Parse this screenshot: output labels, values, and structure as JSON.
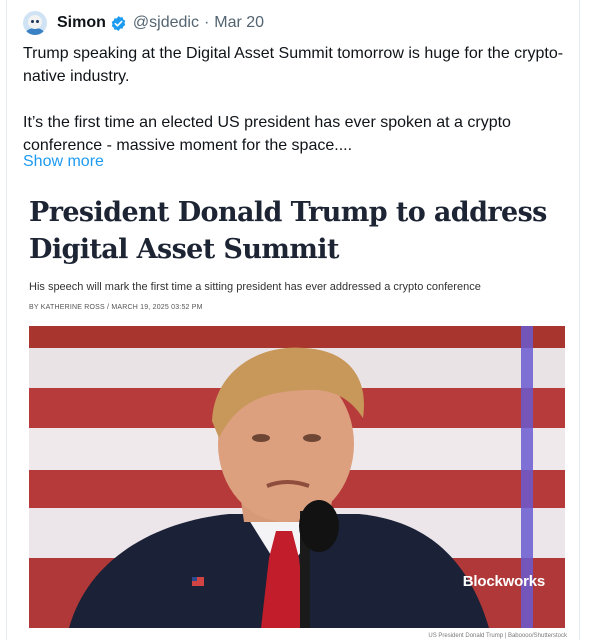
{
  "tweet": {
    "author": {
      "name": "Simon",
      "handle": "@sjdedic",
      "date": "Mar 20"
    },
    "text_lines": [
      "Trump speaking at the Digital Asset Summit tomorrow is huge for the crypto-native industry.",
      "It’s the first time an elected US president has ever spoken at a crypto conference - massive moment for the space...."
    ],
    "show_more": "Show more"
  },
  "card": {
    "headline": "President Donald Trump to address Digital Asset Summit",
    "subheadline": "His speech will mark the first time a sitting president has ever addressed a crypto conference",
    "byline": "BY KATHERINE ROSS / MARCH 19, 2025 03:52 PM",
    "brand": "Blockworks",
    "caption": "US President Donald Trump | Baboooo/Shutterstock"
  },
  "colors": {
    "verified_badge": "#1d9bf0",
    "link": "#1d9bf0",
    "stripe_red": "#b73a3a",
    "headline": "#1d2433"
  },
  "icons": [
    "verified-badge-icon",
    "avatar"
  ]
}
